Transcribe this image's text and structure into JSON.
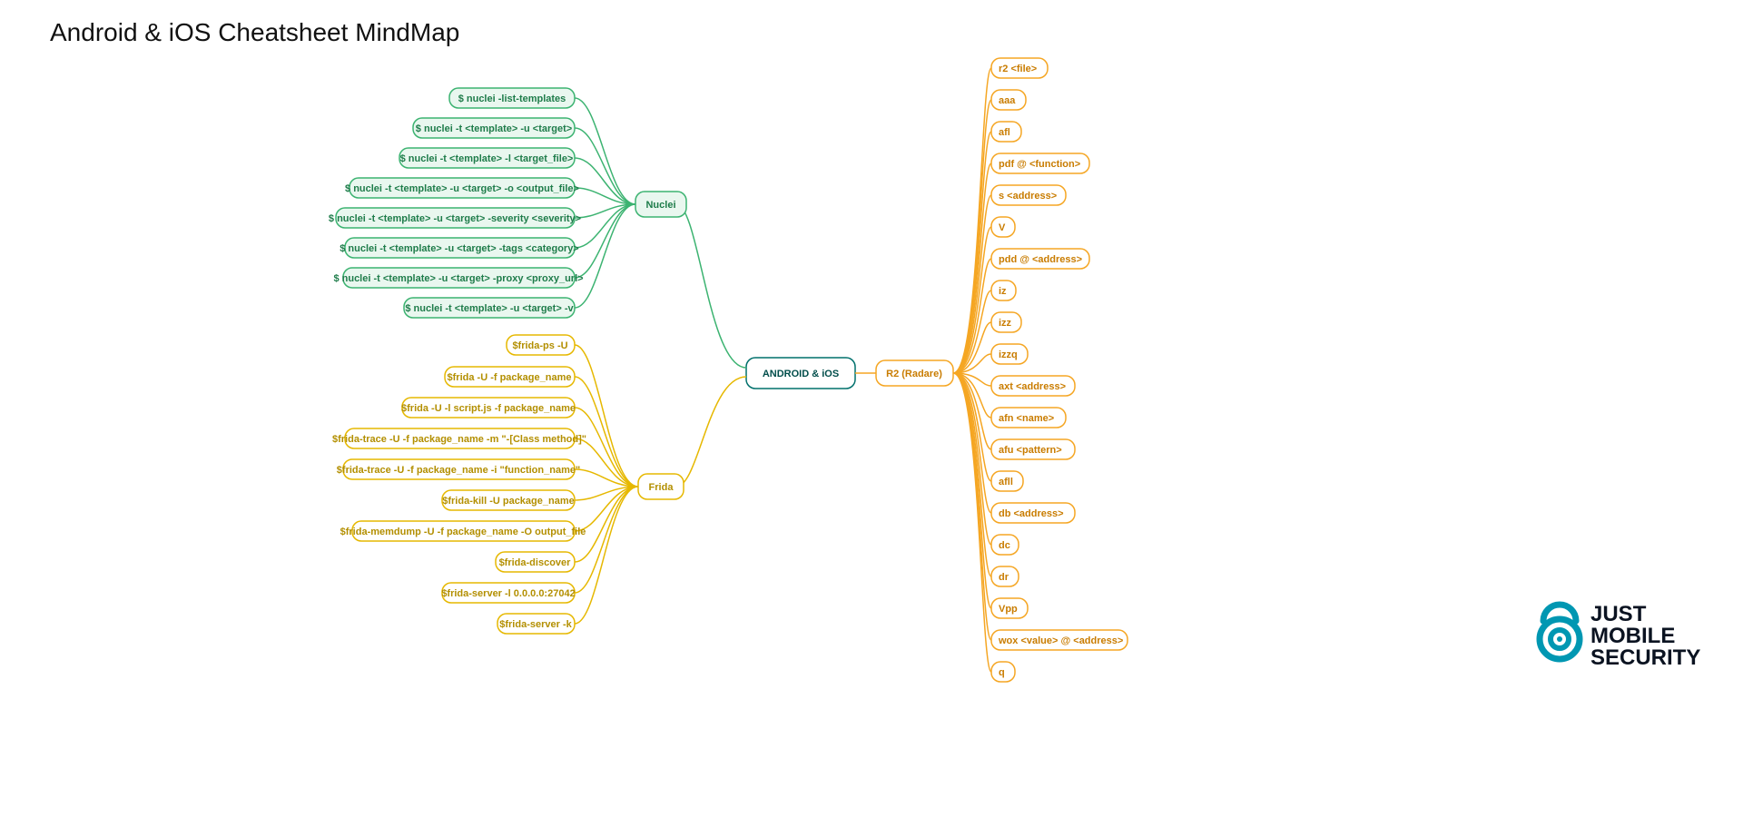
{
  "title": "Android & iOS Cheatsheet MindMap",
  "root": {
    "label": "ANDROID & iOS"
  },
  "branches": {
    "nuclei": {
      "label": "Nuclei",
      "items": [
        "$ nuclei -list-templates",
        "$ nuclei -t <template> -u <target>",
        "$ nuclei -t <template> -l <target_file>",
        "$ nuclei -t <template> -u <target> -o <output_file>",
        "$ nuclei -t <template> -u <target> -severity <severity>",
        "$ nuclei -t <template> -u <target> -tags <category>",
        "$ nuclei -t <template> -u <target> -proxy <proxy_url>",
        "$ nuclei -t <template> -u <target> -v"
      ]
    },
    "frida": {
      "label": "Frida",
      "items": [
        "$frida-ps -U",
        "$frida -U -f package_name",
        "$frida -U -l script.js -f package_name",
        "$frida-trace -U -f package_name -m \"-[Class method]\"",
        "$frida-trace -U -f package_name -i \"function_name\"",
        "$frida-kill -U package_name",
        "$frida-memdump -U -f package_name -O output_file",
        "$frida-discover",
        "$frida-server -l 0.0.0.0:27042",
        "$frida-server -k"
      ]
    },
    "radare": {
      "label": "R2 (Radare)",
      "items": [
        "r2 <file>",
        "aaa",
        "afl",
        "pdf @ <function>",
        "s <address>",
        "V",
        "pdd @ <address>",
        "iz",
        "izz",
        "izzq",
        "axt <address>",
        "afn <name>",
        "afu <pattern>",
        "afll",
        "db <address>",
        "dc",
        "dr",
        "Vpp",
        "wox <value> @ <address>",
        "q"
      ]
    }
  },
  "logo": {
    "line1": "JUST",
    "line2": "MOBILE",
    "line3": "SECURITY"
  }
}
